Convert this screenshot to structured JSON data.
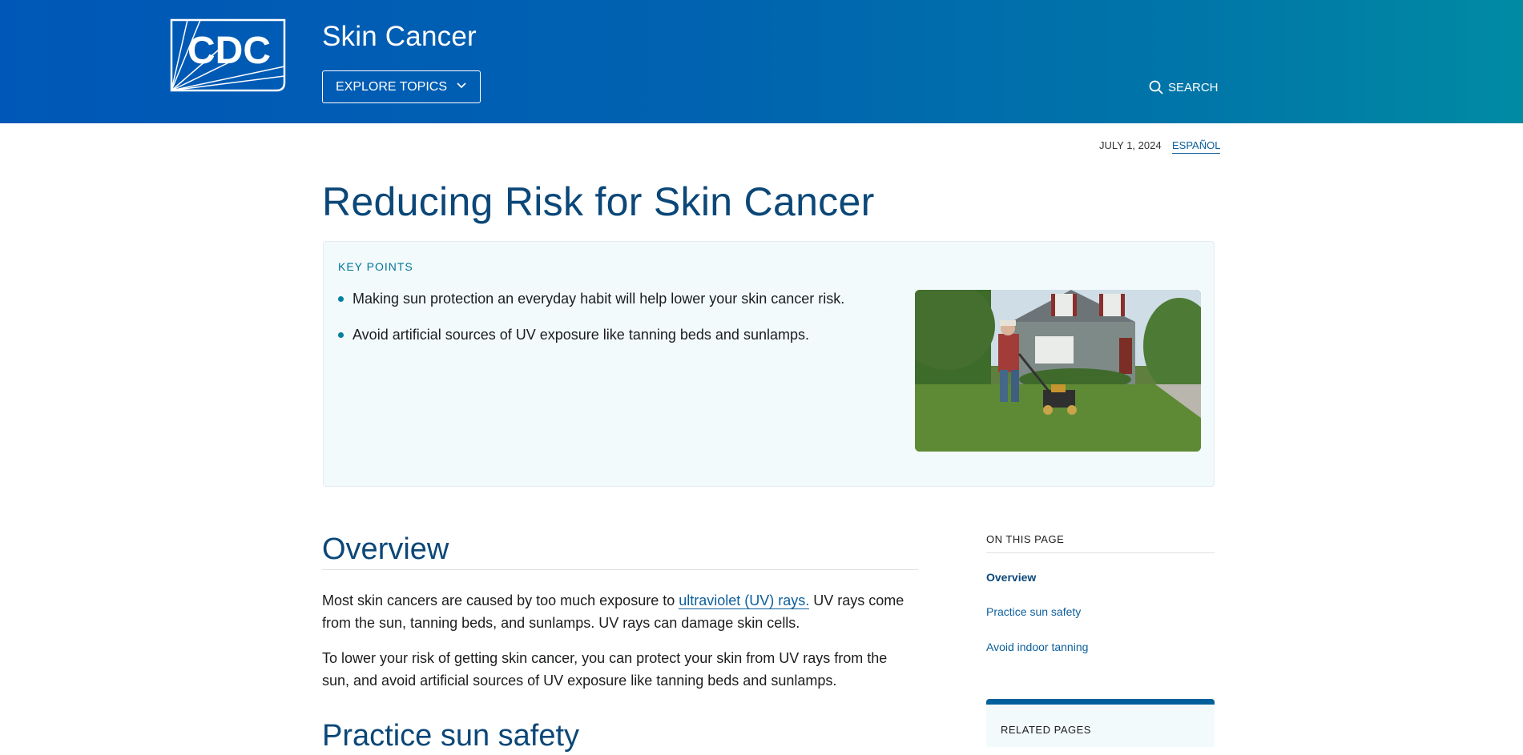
{
  "header": {
    "logo_text": "CDC",
    "site_title": "Skin Cancer",
    "explore_label": "EXPLORE TOPICS",
    "search_label": "SEARCH"
  },
  "meta": {
    "date": "JULY 1, 2024",
    "language_link": "ESPAÑOL"
  },
  "page": {
    "title": "Reducing Risk for Skin Cancer"
  },
  "key_points": {
    "label": "KEY POINTS",
    "items": [
      "Making sun protection an everyday habit will help lower your skin cancer risk.",
      "Avoid artificial sources of UV exposure like tanning beds and sunlamps."
    ]
  },
  "overview": {
    "heading": "Overview",
    "p1_before": "Most skin cancers are caused by too much exposure to ",
    "p1_link": "ultraviolet (UV) rays.",
    "p1_after": " UV rays come from the sun, tanning beds, and sunlamps. UV rays can damage skin cells.",
    "p2": "To lower your risk of getting skin cancer, you can protect your skin from UV rays from the sun, and avoid artificial sources of UV exposure like tanning beds and sunlamps.",
    "next_heading": "Practice sun safety"
  },
  "on_this_page": {
    "label": "ON THIS PAGE",
    "links": [
      "Overview",
      "Practice sun safety",
      "Avoid indoor tanning"
    ]
  },
  "related": {
    "label": "RELATED PAGES"
  },
  "colors": {
    "header_start": "#0057b7",
    "header_end": "#008ba3",
    "heading": "#0b4778",
    "link": "#0b5e9c",
    "accent": "#00829c"
  }
}
